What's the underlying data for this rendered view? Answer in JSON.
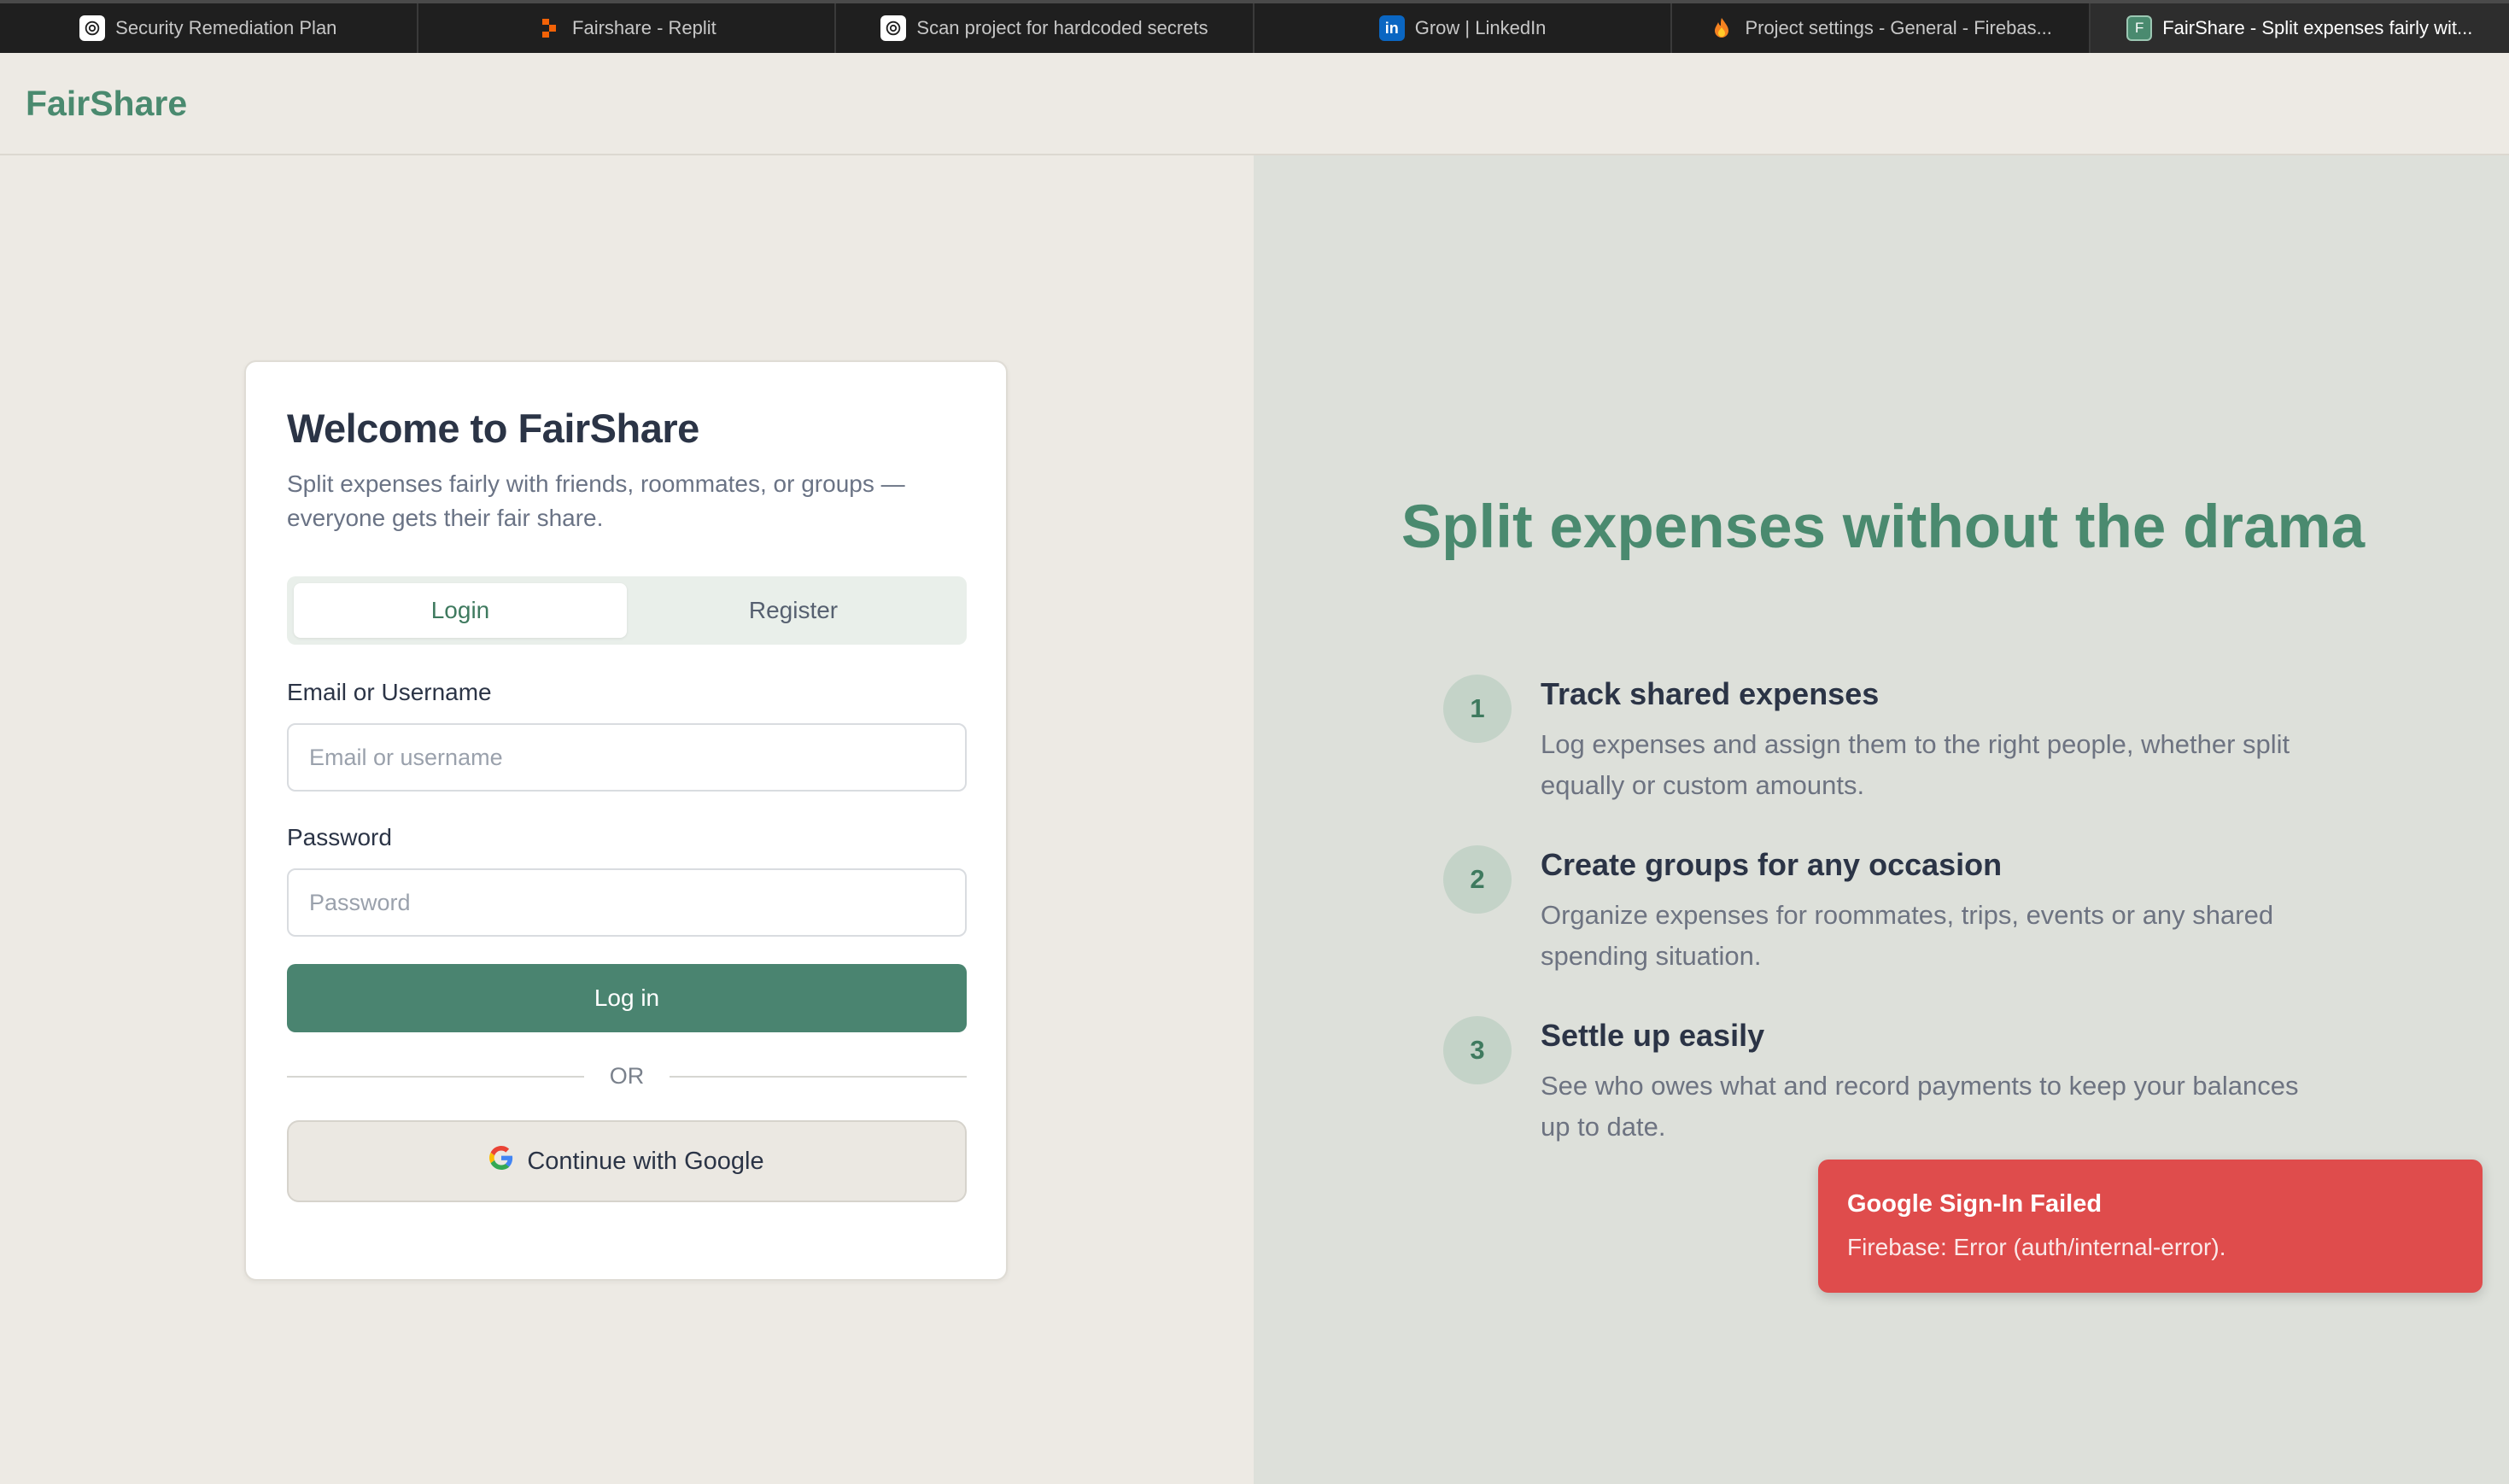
{
  "browser": {
    "tabs": [
      {
        "label": "Security Remediation Plan",
        "icon": "openai-icon"
      },
      {
        "label": "Fairshare - Replit",
        "icon": "replit-icon"
      },
      {
        "label": "Scan project for hardcoded secrets",
        "icon": "openai-icon"
      },
      {
        "label": "Grow | LinkedIn",
        "icon": "linkedin-icon"
      },
      {
        "label": "Project settings - General - Firebas...",
        "icon": "firebase-icon"
      },
      {
        "label": "FairShare - Split expenses fairly wit...",
        "icon": "fairshare-icon",
        "active": true
      }
    ],
    "favicon_letters": {
      "linkedin": "in",
      "fairshare": "F"
    }
  },
  "header": {
    "brand": "FairShare"
  },
  "login": {
    "title": "Welcome to FairShare",
    "subtitle": "Split expenses fairly with friends, roommates, or groups — everyone gets their fair share.",
    "tabs": [
      {
        "label": "Login",
        "active": true
      },
      {
        "label": "Register",
        "active": false
      }
    ],
    "email_label": "Email or Username",
    "email_placeholder": "Email or username",
    "password_label": "Password",
    "password_placeholder": "Password",
    "submit_label": "Log in",
    "divider_text": "OR",
    "google_label": "Continue with Google"
  },
  "hero": {
    "title": "Split expenses without the drama",
    "features": [
      {
        "num": "1",
        "title": "Track shared expenses",
        "desc": "Log expenses and assign them to the right people, whether split equally or custom amounts."
      },
      {
        "num": "2",
        "title": "Create groups for any occasion",
        "desc": "Organize expenses for roommates, trips, events or any shared spending situation."
      },
      {
        "num": "3",
        "title": "Settle up easily",
        "desc": "See who owes what and record payments to keep your balances up to date."
      }
    ]
  },
  "toast": {
    "title": "Google Sign-In Failed",
    "message": "Firebase: Error (auth/internal-error)."
  },
  "colors": {
    "brand": "#4a8a6f",
    "primary_button": "#4a8470",
    "toast_error": "#df4c4c",
    "page_bg": "#edeae4",
    "hero_bg": "#dde0da"
  }
}
